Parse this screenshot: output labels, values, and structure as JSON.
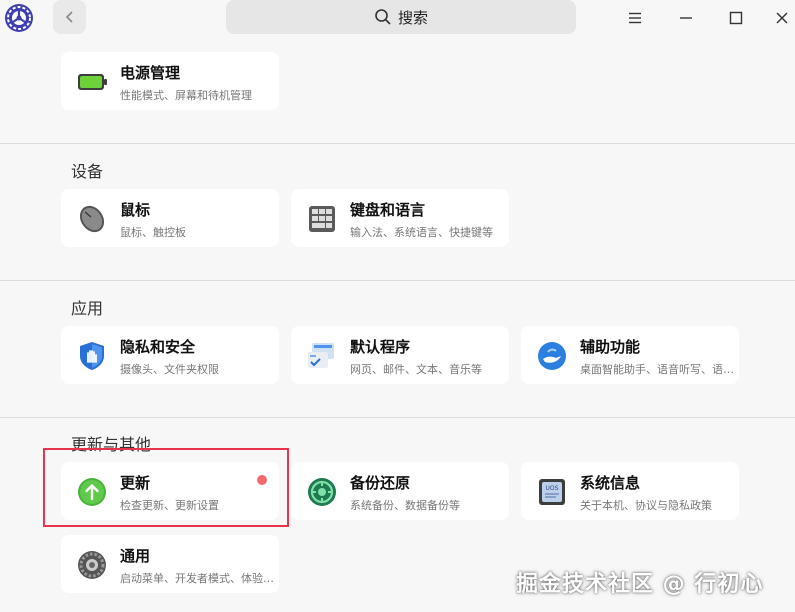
{
  "header": {
    "search_label": "搜索"
  },
  "sections": {
    "top": {
      "power": {
        "title": "电源管理",
        "sub": "性能模式、屏幕和待机管理"
      }
    },
    "devices": {
      "title": "设备",
      "mouse": {
        "title": "鼠标",
        "sub": "鼠标、触控板"
      },
      "keyboard": {
        "title": "键盘和语言",
        "sub": "输入法、系统语言、快捷键等"
      }
    },
    "apps": {
      "title": "应用",
      "privacy": {
        "title": "隐私和安全",
        "sub": "摄像头、文件夹权限"
      },
      "default": {
        "title": "默认程序",
        "sub": "网页、邮件、文本、音乐等"
      },
      "access": {
        "title": "辅助功能",
        "sub": "桌面智能助手、语音听写、语…"
      }
    },
    "other": {
      "title": "更新与其他",
      "update": {
        "title": "更新",
        "sub": "检查更新、更新设置"
      },
      "backup": {
        "title": "备份还原",
        "sub": "系统备份、数据备份等"
      },
      "sysinfo": {
        "title": "系统信息",
        "sub": "关于本机、协议与隐私政策"
      },
      "general": {
        "title": "通用",
        "sub": "启动菜单、开发者模式、体验…"
      }
    }
  },
  "watermark": "掘金技术社区 @ 行初心",
  "colors": {
    "accent_red": "#e8334a",
    "badge": "#f26a6a"
  }
}
